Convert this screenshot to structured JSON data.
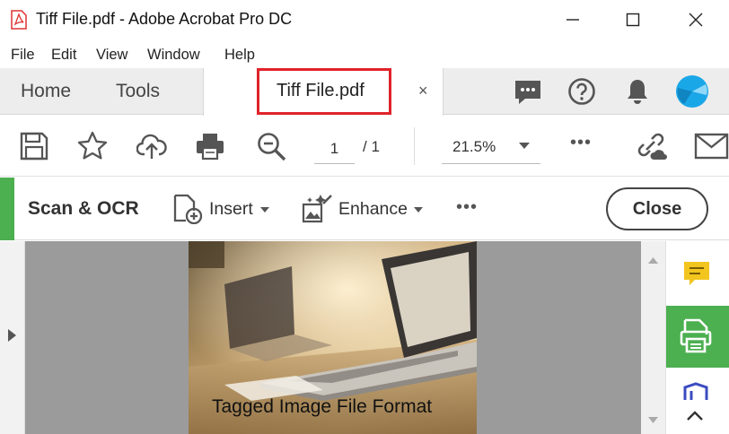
{
  "window": {
    "title": "Tiff File.pdf - Adobe Acrobat Pro DC",
    "app_icon": "acrobat-pdf-icon",
    "controls": [
      "minimize-icon",
      "maximize-icon",
      "close-icon"
    ]
  },
  "menu": {
    "items": [
      "File",
      "Edit",
      "View",
      "Window",
      "Help"
    ]
  },
  "tabs": {
    "home": "Home",
    "tools": "Tools",
    "document": "Tiff File.pdf",
    "close_glyph": "×",
    "right_icons": [
      "comment-icon",
      "help-icon",
      "bell-icon",
      "avatar"
    ]
  },
  "toolbar": {
    "icons": [
      "save-icon",
      "star-icon",
      "upload-cloud-icon",
      "print-icon",
      "zoom-out-icon"
    ],
    "page_current": "1",
    "page_total": "/ 1",
    "zoom": "21.5%",
    "more": "•••",
    "right_icons": [
      "share-link-icon",
      "email-icon"
    ]
  },
  "scan_toolbar": {
    "title": "Scan & OCR",
    "insert": "Insert",
    "enhance": "Enhance",
    "more": "•••",
    "close": "Close"
  },
  "document": {
    "caption": "Tagged Image File Format"
  },
  "right_rail": {
    "icons": [
      "comment-tool-icon",
      "export-pdf-icon",
      "organize-icon",
      "chevron-up-icon"
    ]
  },
  "colors": {
    "accent_green": "#4caf50",
    "highlight_red": "#e0232a",
    "comment_yellow": "#f2c51f",
    "avatar_blue": "#1aa7e8"
  }
}
